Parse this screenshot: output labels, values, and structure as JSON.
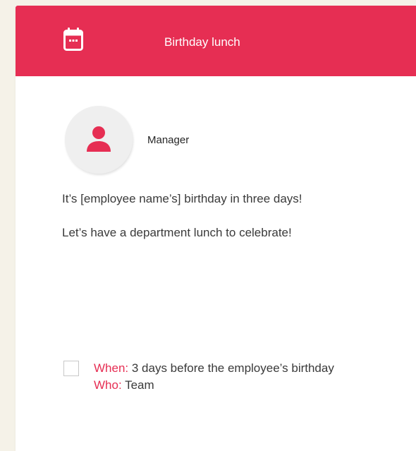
{
  "header": {
    "icon": "calendar-icon",
    "title": "Birthday lunch"
  },
  "author": {
    "icon": "person-icon",
    "name": "Manager"
  },
  "message": {
    "paragraphs": [
      "It’s [employee name’s] birthday in three days!",
      "Let’s have a department lunch to celebrate!"
    ]
  },
  "task": {
    "checked": false,
    "when_label": "When:",
    "when_value": " 3 days before the employee’s birthday",
    "who_label": "Who:",
    "who_value": " Team"
  },
  "colors": {
    "accent": "#e62e53",
    "background": "#f5f2e8",
    "card": "#ffffff"
  }
}
